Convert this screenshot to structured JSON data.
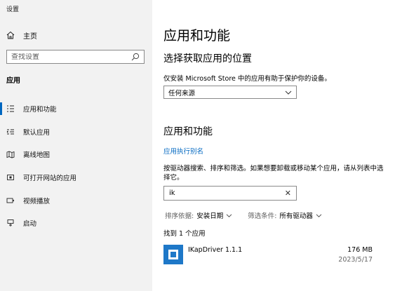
{
  "window": {
    "title": "设置"
  },
  "sidebar": {
    "home_label": "主页",
    "search_placeholder": "查找设置",
    "section_label": "应用",
    "items": [
      {
        "label": "应用和功能",
        "icon": "apps-features-icon",
        "active": true
      },
      {
        "label": "默认应用",
        "icon": "default-apps-icon",
        "active": false
      },
      {
        "label": "离线地图",
        "icon": "offline-maps-icon",
        "active": false
      },
      {
        "label": "可打开网站的应用",
        "icon": "apps-for-websites-icon",
        "active": false
      },
      {
        "label": "视频播放",
        "icon": "video-playback-icon",
        "active": false
      },
      {
        "label": "启动",
        "icon": "startup-icon",
        "active": false
      }
    ]
  },
  "main": {
    "title": "应用和功能",
    "install_section": {
      "heading": "选择获取应用的位置",
      "description": "仅安装 Microsoft Store 中的应用有助于保护你的设备。",
      "select_value": "任何来源"
    },
    "apps_section": {
      "heading": "应用和功能",
      "alias_link": "应用执行别名",
      "description": "按驱动器搜索、排序和筛选。如果想要卸载或移动某个应用，请从列表中选择它。",
      "search_value": "ik",
      "sort_label": "排序依据:",
      "sort_value": "安装日期",
      "filter_label": "筛选条件:",
      "filter_value": "所有驱动器",
      "found_text": "找到 1 个应用",
      "apps": [
        {
          "name": "IKapDriver 1.1.1",
          "size": "176 MB",
          "date": "2023/5/17"
        }
      ]
    }
  },
  "colors": {
    "accent": "#0067c0",
    "sidebar_bg": "#f2f2f2",
    "app_icon": "#1e78c8"
  }
}
